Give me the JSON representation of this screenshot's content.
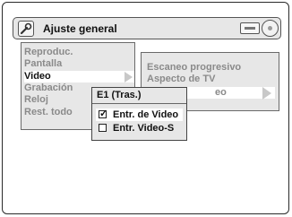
{
  "header": {
    "title": "Ajuste general",
    "left_icon": "wrench-icon",
    "right_icons": [
      "disc-tray-icon",
      "disc-icon"
    ]
  },
  "main_menu": {
    "items": [
      {
        "label": "Reproduc.",
        "selected": false
      },
      {
        "label": "Pantalla",
        "selected": false
      },
      {
        "label": "Video",
        "selected": true
      },
      {
        "label": "Grabación",
        "selected": false
      },
      {
        "label": "Reloj",
        "selected": false
      },
      {
        "label": "Rest. todo",
        "selected": false
      }
    ]
  },
  "sub_menu": {
    "items": [
      {
        "label": "Escaneo progresivo"
      },
      {
        "label": "Aspecto de TV"
      },
      {
        "label": "eo"
      }
    ]
  },
  "popup": {
    "title": "E1 (Tras.)",
    "options": [
      {
        "label": "Entr. de Video",
        "checked": true
      },
      {
        "label": "Entr. Video-S",
        "checked": false
      }
    ]
  }
}
